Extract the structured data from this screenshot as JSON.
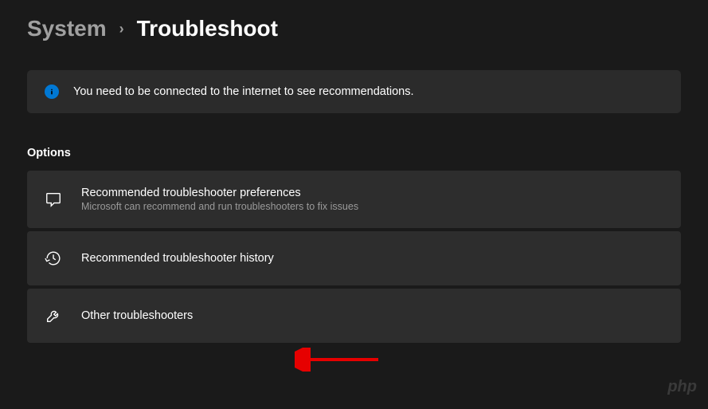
{
  "breadcrumb": {
    "parent": "System",
    "separator": "›",
    "current": "Troubleshoot"
  },
  "info_banner": {
    "text": "You need to be connected to the internet to see recommendations."
  },
  "section_label": "Options",
  "options": [
    {
      "title": "Recommended troubleshooter preferences",
      "subtitle": "Microsoft can recommend and run troubleshooters to fix issues"
    },
    {
      "title": "Recommended troubleshooter history",
      "subtitle": ""
    },
    {
      "title": "Other troubleshooters",
      "subtitle": ""
    }
  ],
  "watermark": "php"
}
